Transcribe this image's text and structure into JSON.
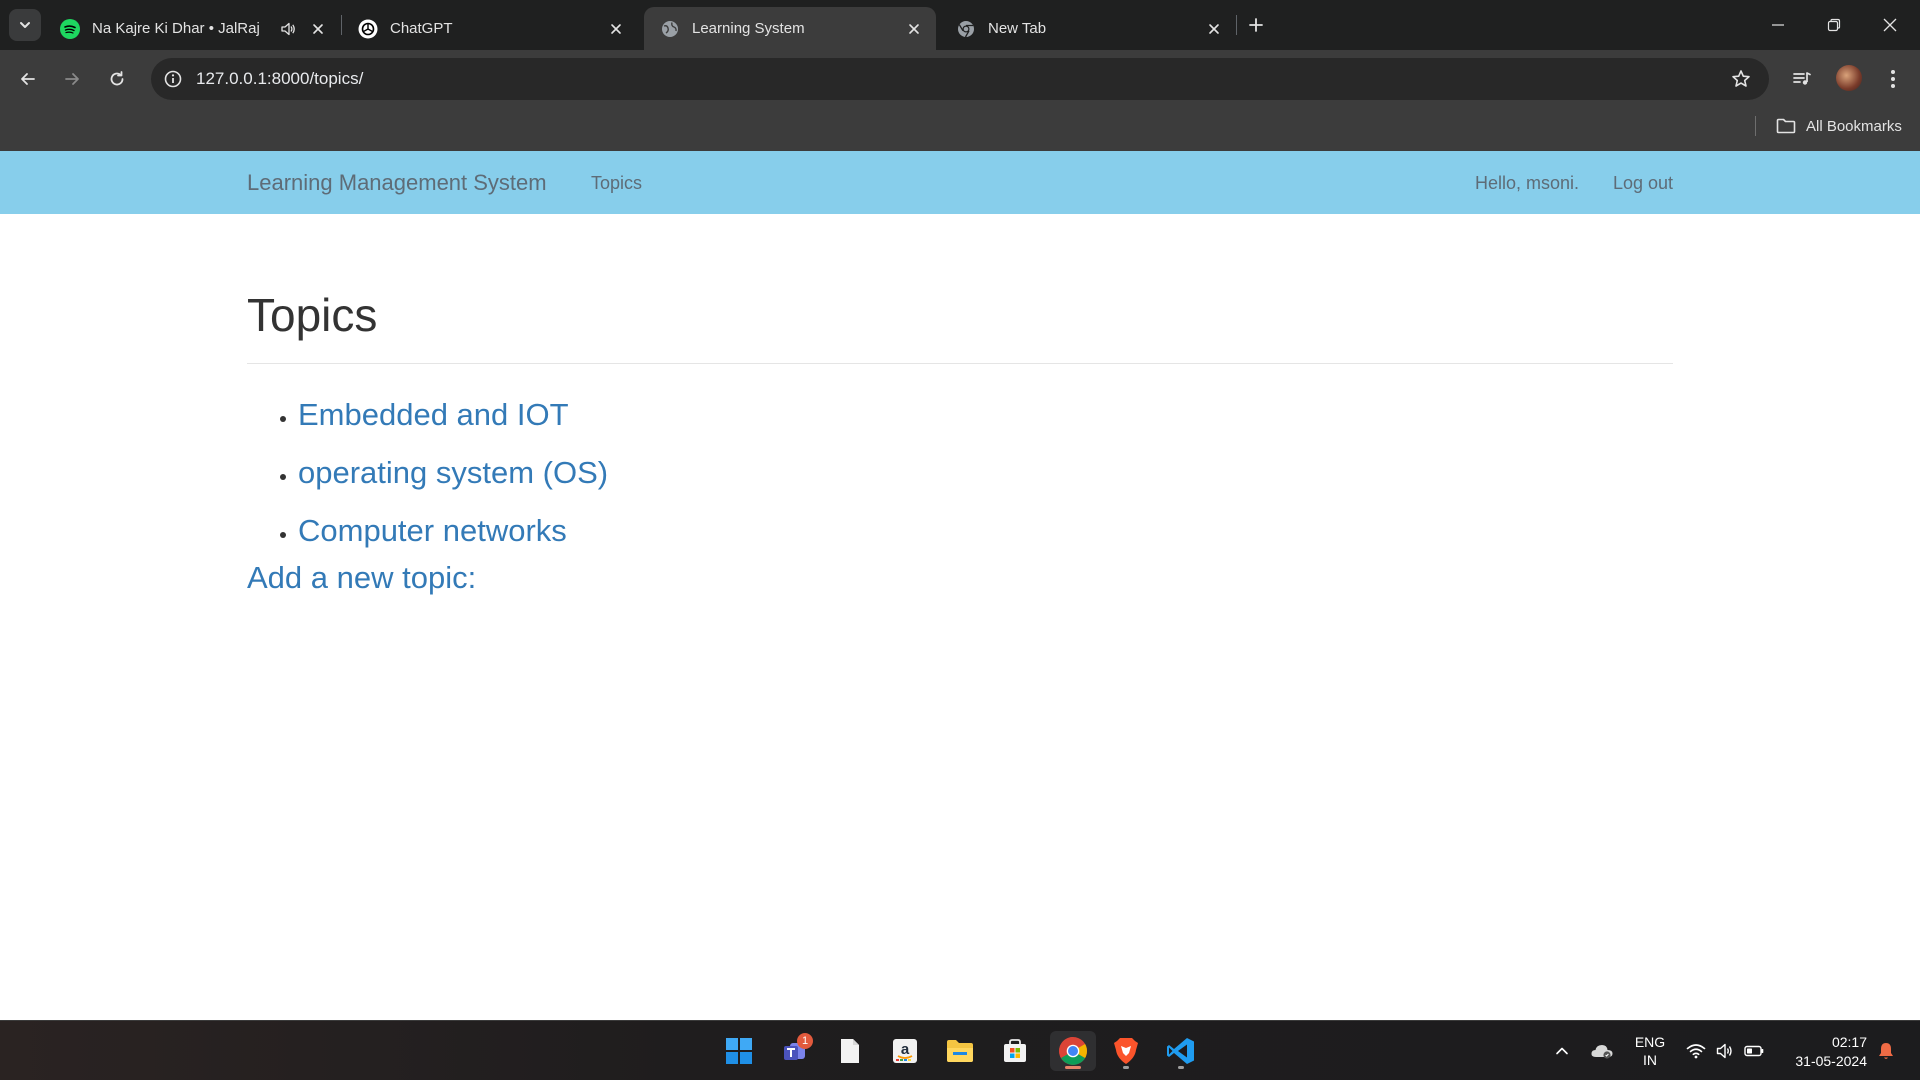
{
  "browser": {
    "tabs": [
      {
        "title": "Na Kajre Ki Dhar • JalRaj",
        "icon": "spotify-icon",
        "audio": true
      },
      {
        "title": "ChatGPT",
        "icon": "chatgpt-icon"
      },
      {
        "title": "Learning System",
        "icon": "globe-icon",
        "active": true
      },
      {
        "title": "New Tab",
        "icon": "chrome-icon"
      }
    ],
    "url": "127.0.0.1:8000/topics/",
    "bookmarks_label": "All Bookmarks"
  },
  "site": {
    "brand": "Learning Management System",
    "nav": {
      "topics": "Topics"
    },
    "user": {
      "greeting": "Hello, msoni.",
      "logout": "Log out"
    },
    "accent": "#87ceeb",
    "link_color": "#337ab7"
  },
  "main": {
    "title": "Topics",
    "topics": [
      "Embedded and IOT",
      "operating system (OS)",
      "Computer networks"
    ],
    "add_link": "Add a new topic:"
  },
  "taskbar": {
    "apps": [
      "start-icon",
      "teams-icon",
      "notepad-icon",
      "amazon-icon",
      "file-explorer-icon",
      "microsoft-store-icon",
      "chrome-icon",
      "brave-icon",
      "vscode-icon"
    ],
    "teams_badge": "1",
    "language": [
      "ENG",
      "IN"
    ],
    "time": "02:17",
    "date": "31-05-2024"
  }
}
